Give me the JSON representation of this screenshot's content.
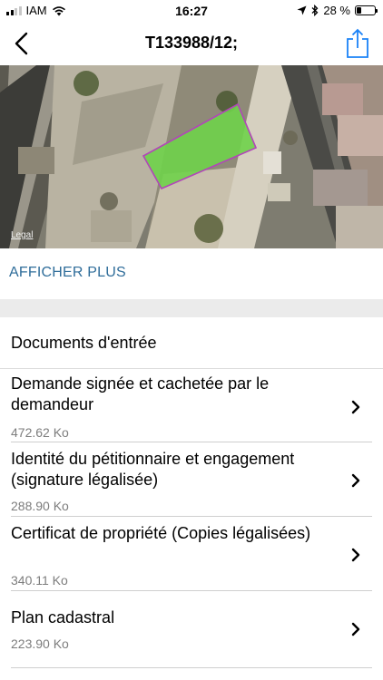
{
  "status_bar": {
    "carrier": "IAM",
    "time": "16:27",
    "battery_text": "28 %",
    "battery_level": 0.28,
    "signal_bars": 4,
    "signal_bars_filled": 2
  },
  "nav": {
    "title": "T133988/12;"
  },
  "map": {
    "legal_label": "Legal",
    "parcel_color": "#6fd24a",
    "parcel_outline_color": "#b245b9"
  },
  "details": {
    "show_more_label": "AFFICHER PLUS"
  },
  "documents": {
    "section_title": "Documents d'entrée",
    "items": [
      {
        "title": "Demande signée et cachetée par le demandeur",
        "size": "472.62 Ko"
      },
      {
        "title": "Identité du pétitionnaire et engagement (signature légalisée)",
        "size": "288.90 Ko"
      },
      {
        "title": "Certificat de propriété (Copies légalisées)",
        "size": "340.11 Ko"
      },
      {
        "title": "Plan cadastral",
        "size": "223.90 Ko"
      }
    ]
  },
  "colors": {
    "accent": "#2f6d9a",
    "ios_blue": "#1a82f7",
    "secondary_text": "#7d7d7d"
  }
}
